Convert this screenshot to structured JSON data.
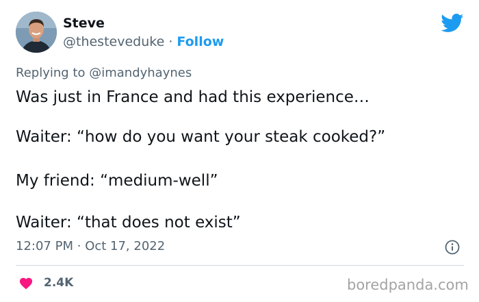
{
  "author": {
    "name": "Steve",
    "handle": "@thesteveduke",
    "separator": "·",
    "follow_label": "Follow"
  },
  "reply": {
    "prefix": "Replying to",
    "mention": "@imandyhaynes"
  },
  "tweet": {
    "lines": [
      "Was just in France and had this experience…",
      "Waiter: “how do you want your steak cooked?”",
      "My friend: “medium-well”",
      "Waiter: “that does not exist”"
    ],
    "time": "12:07 PM",
    "separator": "·",
    "date": "Oct 17, 2022"
  },
  "engagement": {
    "likes": "2.4K"
  },
  "watermark": "boredpanda.com",
  "icons": {
    "platform": "twitter-bird-icon",
    "info": "info-icon",
    "like": "heart-icon"
  },
  "colors": {
    "accent": "#1d9bf0",
    "like": "#f91880",
    "secondary_text": "#536471",
    "text": "#0f1419"
  }
}
